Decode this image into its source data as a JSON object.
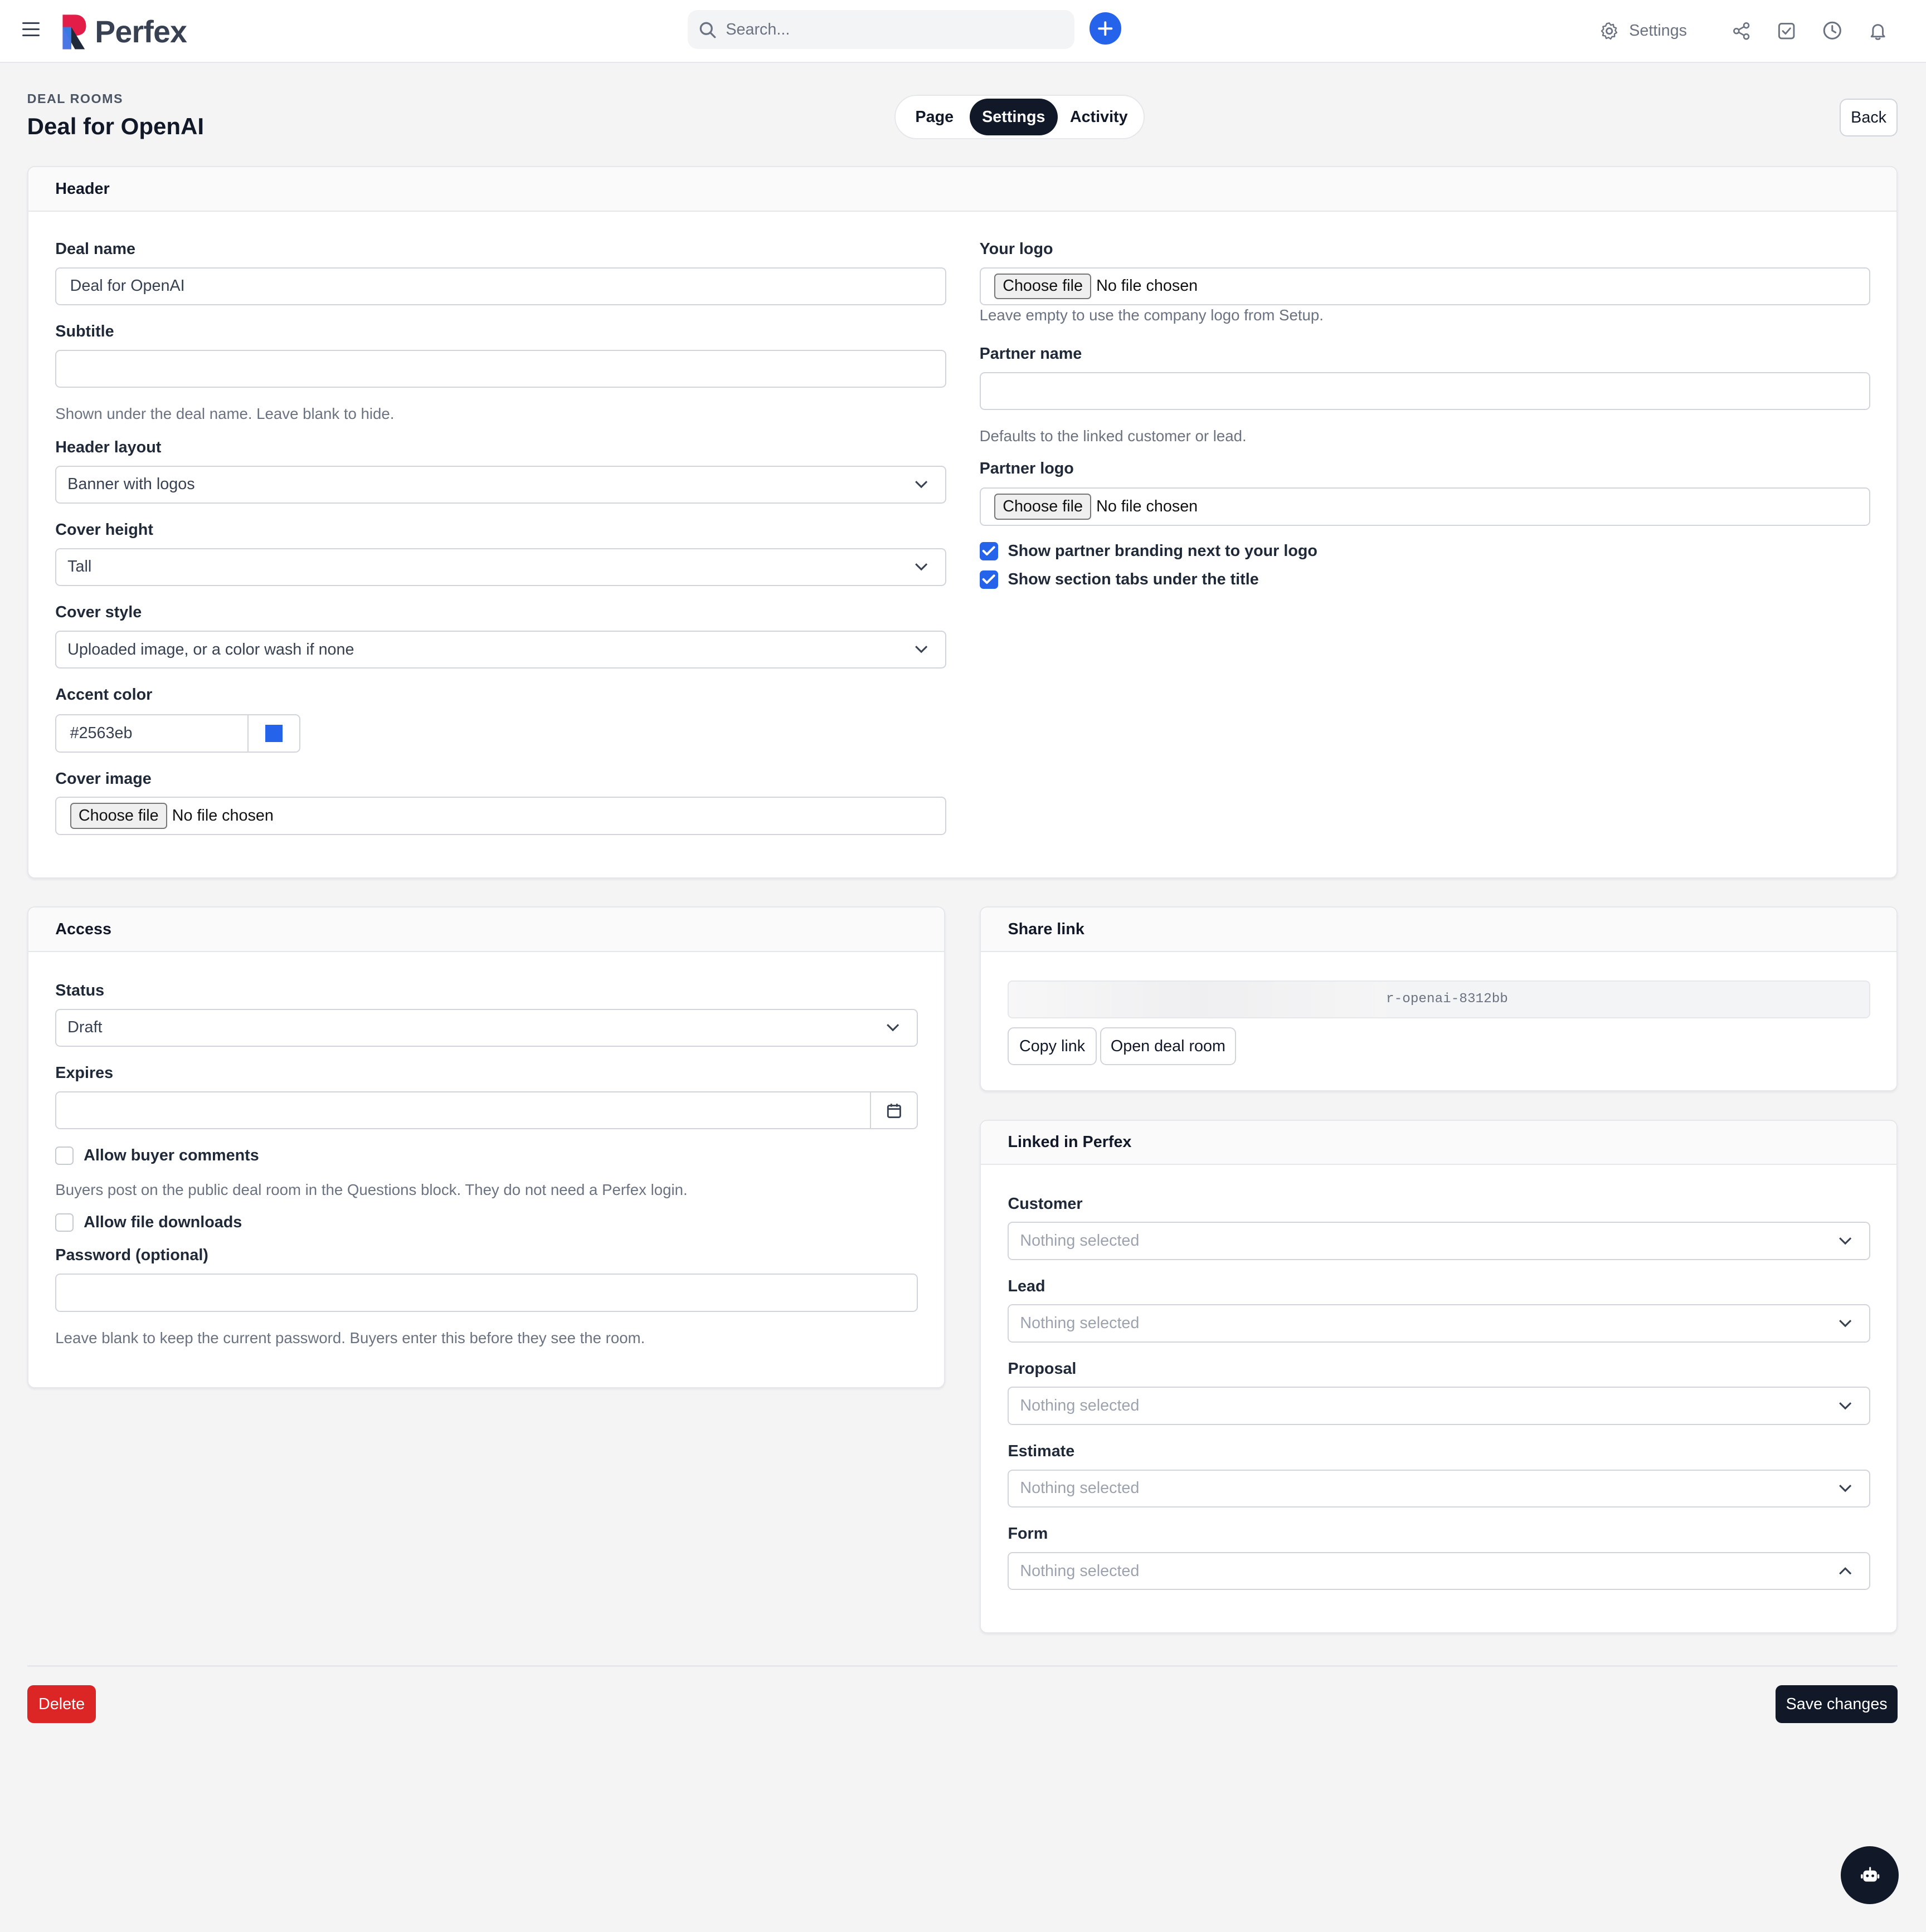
{
  "topbar": {
    "app_name": "Perfex",
    "search_placeholder": "Search...",
    "settings_label": "Settings"
  },
  "page": {
    "eyebrow": "DEAL ROOMS",
    "title": "Deal for OpenAI",
    "tabs": [
      {
        "label": "Page",
        "active": false
      },
      {
        "label": "Settings",
        "active": true
      },
      {
        "label": "Activity",
        "active": false
      }
    ],
    "back_label": "Back"
  },
  "header_card": {
    "title": "Header",
    "deal_name_label": "Deal name",
    "deal_name_value": "Deal for OpenAI",
    "subtitle_label": "Subtitle",
    "subtitle_value": "",
    "subtitle_help": "Shown under the deal name. Leave blank to hide.",
    "header_layout_label": "Header layout",
    "header_layout_value": "Banner with logos",
    "cover_height_label": "Cover height",
    "cover_height_value": "Tall",
    "cover_style_label": "Cover style",
    "cover_style_value": "Uploaded image, or a color wash if none",
    "accent_color_label": "Accent color",
    "accent_color_value": "#2563eb",
    "cover_image_label": "Cover image",
    "choose_file_label": "Choose file",
    "no_file_label": "No file chosen",
    "your_logo_label": "Your logo",
    "your_logo_help": "Leave empty to use the company logo from Setup.",
    "partner_name_label": "Partner name",
    "partner_name_value": "",
    "partner_name_help": "Defaults to the linked customer or lead.",
    "partner_logo_label": "Partner logo",
    "show_partner_branding_label": "Show partner branding next to your logo",
    "show_partner_branding_checked": true,
    "show_section_tabs_label": "Show section tabs under the title",
    "show_section_tabs_checked": true
  },
  "access_card": {
    "title": "Access",
    "status_label": "Status",
    "status_value": "Draft",
    "expires_label": "Expires",
    "expires_value": "",
    "allow_comments_label": "Allow buyer comments",
    "allow_comments_checked": false,
    "allow_comments_help": "Buyers post on the public deal room in the Questions block. They do not need a Perfex login.",
    "allow_downloads_label": "Allow file downloads",
    "allow_downloads_checked": false,
    "password_label": "Password (optional)",
    "password_value": "",
    "password_help": "Leave blank to keep the current password. Buyers enter this before they see the room."
  },
  "share_card": {
    "title": "Share link",
    "link_suffix": "r-openai-8312bb",
    "copy_label": "Copy link",
    "open_label": "Open deal room"
  },
  "linked_card": {
    "title": "Linked in Perfex",
    "fields": [
      {
        "label": "Customer",
        "value": "Nothing selected"
      },
      {
        "label": "Lead",
        "value": "Nothing selected"
      },
      {
        "label": "Proposal",
        "value": "Nothing selected"
      },
      {
        "label": "Estimate",
        "value": "Nothing selected"
      },
      {
        "label": "Form",
        "value": "Nothing selected"
      }
    ]
  },
  "footer": {
    "delete_label": "Delete",
    "save_label": "Save changes"
  },
  "colors": {
    "accent": "#2563eb",
    "danger": "#dc2626",
    "dark": "#111827"
  },
  "icons": [
    "hamburger-icon",
    "search-icon",
    "plus-icon",
    "gear-icon",
    "share-icon",
    "task-check-icon",
    "clock-icon",
    "bell-icon",
    "chevron-down-icon",
    "chevron-up-icon",
    "calendar-icon",
    "check-icon",
    "robot-icon"
  ]
}
